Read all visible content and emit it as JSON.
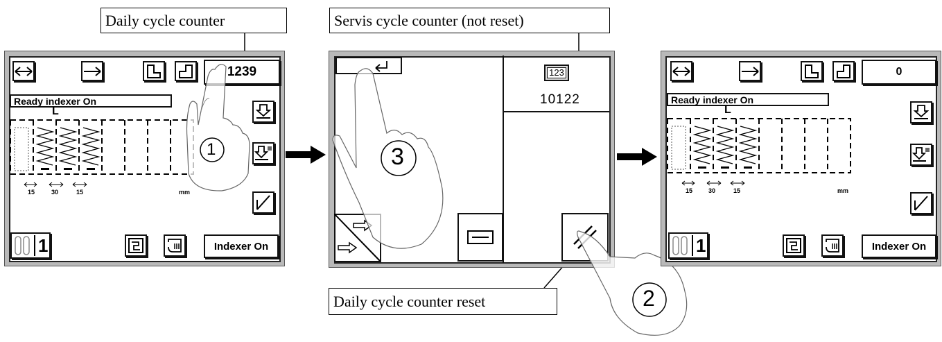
{
  "callouts": {
    "daily_counter": "Daily cycle counter",
    "service_counter": "Servis cycle counter (not reset)",
    "daily_reset": "Daily cycle counter reset"
  },
  "steps": {
    "one": "1",
    "two": "2",
    "three": "3"
  },
  "screen_left": {
    "counter": "1239",
    "status": "Ready indexer On",
    "mark": "L",
    "dims": [
      "15",
      "30",
      "15"
    ],
    "unit": "mm",
    "page": "1",
    "indexer_label": "Indexer On"
  },
  "screen_middle": {
    "counter_icon_label": "123",
    "service_counter": "10122"
  },
  "screen_right": {
    "counter": "0",
    "status": "Ready indexer On",
    "mark": "L",
    "dims": [
      "15",
      "30",
      "15"
    ],
    "unit": "mm",
    "page": "1",
    "indexer_label": "Indexer On"
  },
  "icons": [
    "double-arrow-icon",
    "right-arrow-icon",
    "step-down-icon",
    "step-up-icon",
    "push-down-icon",
    "push-down-multi-icon",
    "slash-icon",
    "sequence-icon",
    "program-icon",
    "cycles-icon",
    "enter-icon",
    "minus-icon",
    "reset-icon",
    "right-arrows-icon",
    "hand-icon",
    "flow-arrow-icon"
  ],
  "colors": {
    "frame": "#b9b9b9",
    "ink": "#111111",
    "background": "#ffffff"
  }
}
